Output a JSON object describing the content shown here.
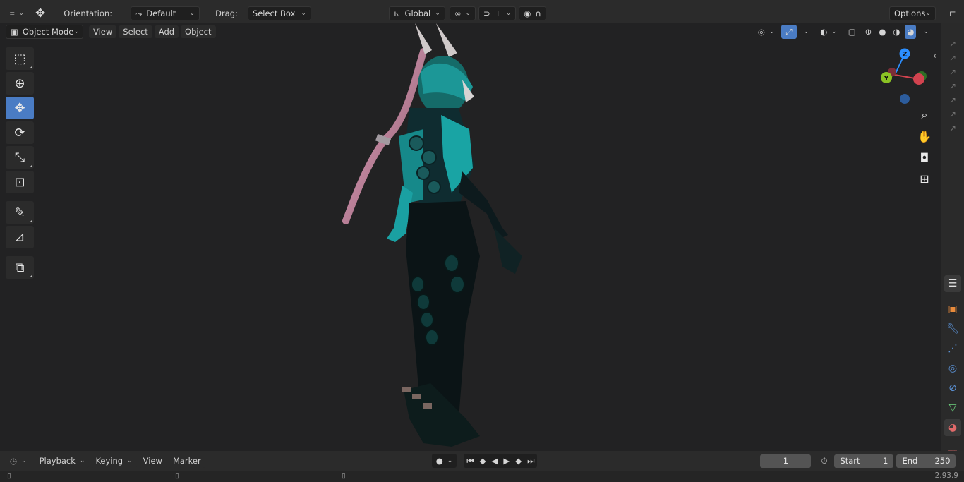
{
  "header": {
    "orientation_label": "Orientation:",
    "orientation_value": "Default",
    "drag_label": "Drag:",
    "drag_value": "Select Box",
    "transform_space": "Global",
    "options_label": "Options"
  },
  "viewport_header": {
    "mode": "Object Mode",
    "menus": [
      "View",
      "Select",
      "Add",
      "Object"
    ]
  },
  "toolbar": {
    "tools": [
      "select-box",
      "cursor",
      "move",
      "rotate",
      "scale",
      "transform",
      "annotate",
      "measure",
      "add-cube"
    ],
    "active": "move"
  },
  "gizmo": {
    "axes": [
      "Z",
      "Y"
    ]
  },
  "timeline": {
    "menus": [
      "Playback",
      "Keying",
      "View",
      "Marker"
    ],
    "current_frame": "1",
    "start_label": "Start",
    "start_value": "1",
    "end_label": "End",
    "end_value": "250"
  },
  "statusbar": {
    "version": "2.93.9"
  },
  "colors": {
    "header_bg": "#2b2b2b",
    "viewport_bg": "#222223",
    "accent_blue": "#4a7cc4",
    "axis_x": "#d2434f",
    "axis_y": "#8bc224",
    "axis_z": "#2c8fff"
  }
}
